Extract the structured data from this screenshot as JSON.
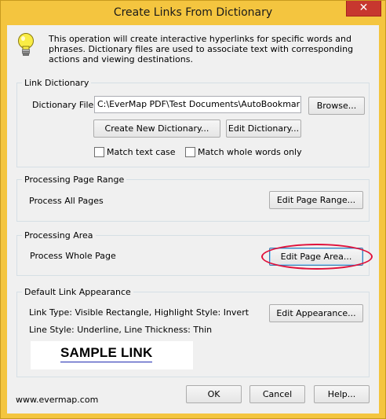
{
  "window": {
    "title": "Create Links From Dictionary",
    "close_glyph": "✕"
  },
  "info": {
    "icon": "lightbulb-icon",
    "text": "This operation will create interactive hyperlinks for specific words and phrases. Dictionary files are used to associate text with corresponding actions and viewing destinations."
  },
  "link_dictionary": {
    "group_label": "Link Dictionary",
    "file_label": "Dictionary File:",
    "file_value": "C:\\EverMap PDF\\Test Documents\\AutoBookmark\\Drug",
    "browse_label": "Browse...",
    "create_label": "Create New Dictionary...",
    "edit_label": "Edit Dictionary...",
    "match_case_label": "Match text case",
    "match_case_checked": false,
    "match_whole_label": "Match whole words only",
    "match_whole_checked": false
  },
  "page_range": {
    "group_label": "Processing Page Range",
    "value": "Process All Pages",
    "edit_label": "Edit Page Range..."
  },
  "area": {
    "group_label": "Processing Area",
    "value": "Process Whole Page",
    "edit_label": "Edit Page Area..."
  },
  "appearance": {
    "group_label": "Default Link Appearance",
    "line1": "Link Type: Visible Rectangle, Highlight Style: Invert",
    "line2": "Line Style: Underline, Line Thickness: Thin",
    "edit_label": "Edit Appearance...",
    "sample_text": "SAMPLE LINK",
    "sample_underline_color": "#1f2bb0"
  },
  "footer": {
    "url": "www.evermap.com",
    "ok_label": "OK",
    "cancel_label": "Cancel",
    "help_label": "Help..."
  },
  "colors": {
    "titlebar": "#f4c53f",
    "close": "#c7372f",
    "highlight_oval": "#e0103a"
  }
}
